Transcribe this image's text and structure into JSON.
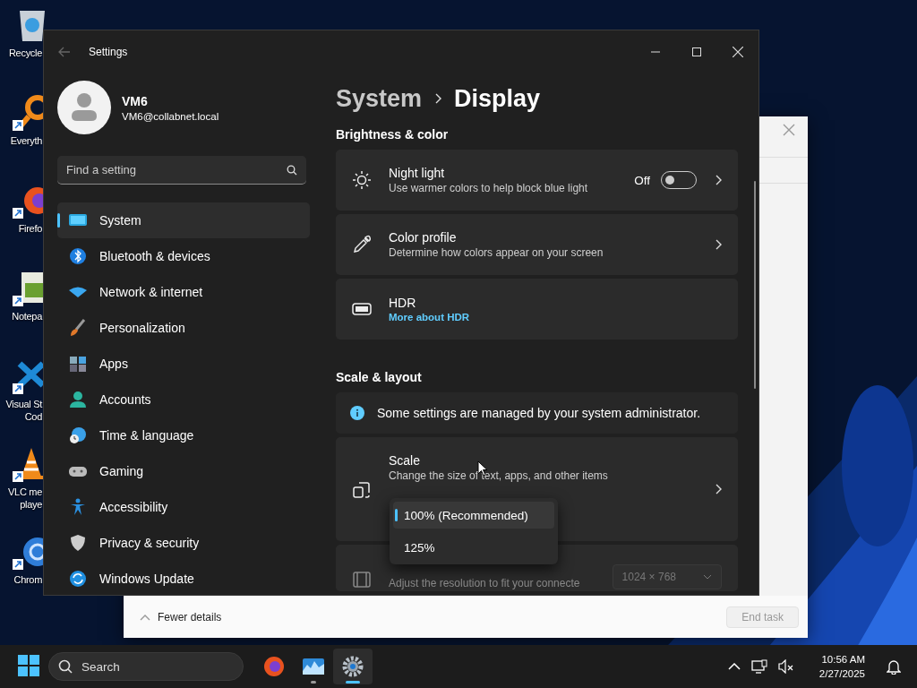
{
  "desktop_icons": [
    {
      "kind": "recycle_bin",
      "lines": [
        "Recycle"
      ],
      "shortcut": false
    },
    {
      "kind": "search_app",
      "lines": [
        "Everyth"
      ],
      "shortcut": true
    },
    {
      "kind": "firefox",
      "lines": [
        "Firefo"
      ],
      "shortcut": true
    },
    {
      "kind": "notepad",
      "lines": [
        "Notepa"
      ],
      "shortcut": true
    },
    {
      "kind": "vscode",
      "lines": [
        "Visual St",
        "Cod"
      ],
      "shortcut": true
    },
    {
      "kind": "vlc",
      "lines": [
        "VLC me",
        "playe"
      ],
      "shortcut": true
    },
    {
      "kind": "chrome",
      "lines": [
        "Chrom"
      ],
      "shortcut": true
    }
  ],
  "task_manager": {
    "footer_toggle": "Fewer details",
    "end_task": {
      "label": "End task",
      "disabled": true
    }
  },
  "settings": {
    "title": "Settings",
    "user": {
      "name": "VM6",
      "email": "VM6@collabnet.local"
    },
    "search": {
      "placeholder": "Find a setting"
    },
    "nav": [
      {
        "kind": "system",
        "label": "System",
        "selected": true
      },
      {
        "kind": "bluetooth",
        "label": "Bluetooth & devices",
        "selected": false
      },
      {
        "kind": "network",
        "label": "Network & internet",
        "selected": false
      },
      {
        "kind": "personalization",
        "label": "Personalization",
        "selected": false
      },
      {
        "kind": "apps",
        "label": "Apps",
        "selected": false
      },
      {
        "kind": "accounts",
        "label": "Accounts",
        "selected": false
      },
      {
        "kind": "time",
        "label": "Time & language",
        "selected": false
      },
      {
        "kind": "gaming",
        "label": "Gaming",
        "selected": false
      },
      {
        "kind": "accessibility",
        "label": "Accessibility",
        "selected": false
      },
      {
        "kind": "privacy",
        "label": "Privacy & security",
        "selected": false
      },
      {
        "kind": "update",
        "label": "Windows Update",
        "selected": false
      }
    ],
    "breadcrumb": {
      "parent": "System",
      "current": "Display"
    },
    "sections": [
      {
        "title": "Brightness & color",
        "cards": [
          {
            "kind": "toggle",
            "title": "Night light",
            "subtitle": "Use warmer colors to help block blue light",
            "state_label": "Off",
            "on": false
          },
          {
            "kind": "link",
            "title": "Color profile",
            "subtitle": "Determine how colors appear on your screen"
          },
          {
            "kind": "info_link",
            "title": "HDR",
            "link": "More about HDR"
          }
        ]
      },
      {
        "title": "Scale & layout",
        "cards": [
          {
            "kind": "notice",
            "text": "Some settings are managed by your system administrator."
          },
          {
            "kind": "dropdown_open",
            "title": "Scale",
            "subtitle": "Change the size of text, apps, and other items",
            "options": [
              {
                "label": "100% (Recommended)",
                "selected": true
              },
              {
                "label": "125%",
                "selected": false
              }
            ]
          },
          {
            "kind": "dropdown",
            "subtitle": "Adjust the resolution to fit your connecte",
            "value": "1024 × 768",
            "disabled": true
          }
        ]
      }
    ]
  },
  "taskbar": {
    "search_placeholder": "Search",
    "apps": [
      {
        "kind": "firefox",
        "running": false,
        "selected": false
      },
      {
        "kind": "task_manager",
        "running": true,
        "selected": false
      },
      {
        "kind": "settings",
        "running": true,
        "selected": true
      }
    ],
    "time": "10:56 AM",
    "date": "2/27/2025"
  }
}
